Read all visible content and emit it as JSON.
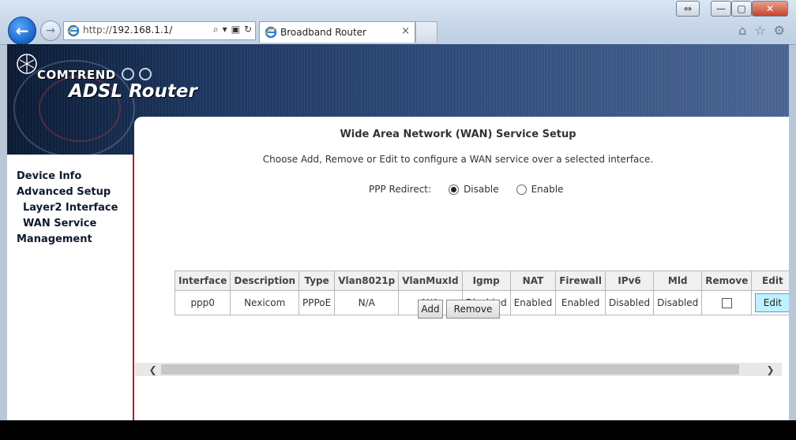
{
  "browser": {
    "url_prefix": "http://",
    "url_host": "192.168.1.1/",
    "tab_title": "Broadband Router",
    "tab_close": "×",
    "back_glyph": "←",
    "forward_glyph": "→",
    "window_buttons": [
      "⇔",
      "—",
      "▢",
      "✕"
    ]
  },
  "banner": {
    "brand": "COMTREND",
    "product": "ADSL Router"
  },
  "sidebar": {
    "items": [
      {
        "label": "Device Info"
      },
      {
        "label": "Advanced Setup"
      },
      {
        "label": "Layer2 Interface"
      },
      {
        "label": "WAN Service"
      },
      {
        "label": "Management"
      }
    ]
  },
  "main": {
    "title": "Wide Area Network (WAN) Service Setup",
    "instructions": "Choose Add, Remove or Edit to configure a WAN service over a selected interface.",
    "ppp_redirect": {
      "label": "PPP Redirect:",
      "options": [
        "Disable",
        "Enable"
      ],
      "selected": "Disable"
    },
    "table": {
      "headers": [
        "Interface",
        "Description",
        "Type",
        "Vlan8021p",
        "VlanMuxId",
        "Igmp",
        "NAT",
        "Firewall",
        "IPv6",
        "Mld",
        "Remove",
        "Edit"
      ],
      "rows": [
        {
          "interface": "ppp0",
          "description": "Nexicom",
          "type": "PPPoE",
          "vlan8021p": "N/A",
          "vlanmuxid": "N/A",
          "igmp": "Disabled",
          "nat": "Enabled",
          "firewall": "Enabled",
          "ipv6": "Disabled",
          "mld": "Disabled",
          "remove_checked": false,
          "edit_label": "Edit"
        }
      ]
    },
    "add_label": "Add",
    "remove_label": "Remove"
  },
  "colors": {
    "sidebar_border": "#b01c2e",
    "edit_button": "#bff0ff",
    "banner": "#1d3760"
  }
}
